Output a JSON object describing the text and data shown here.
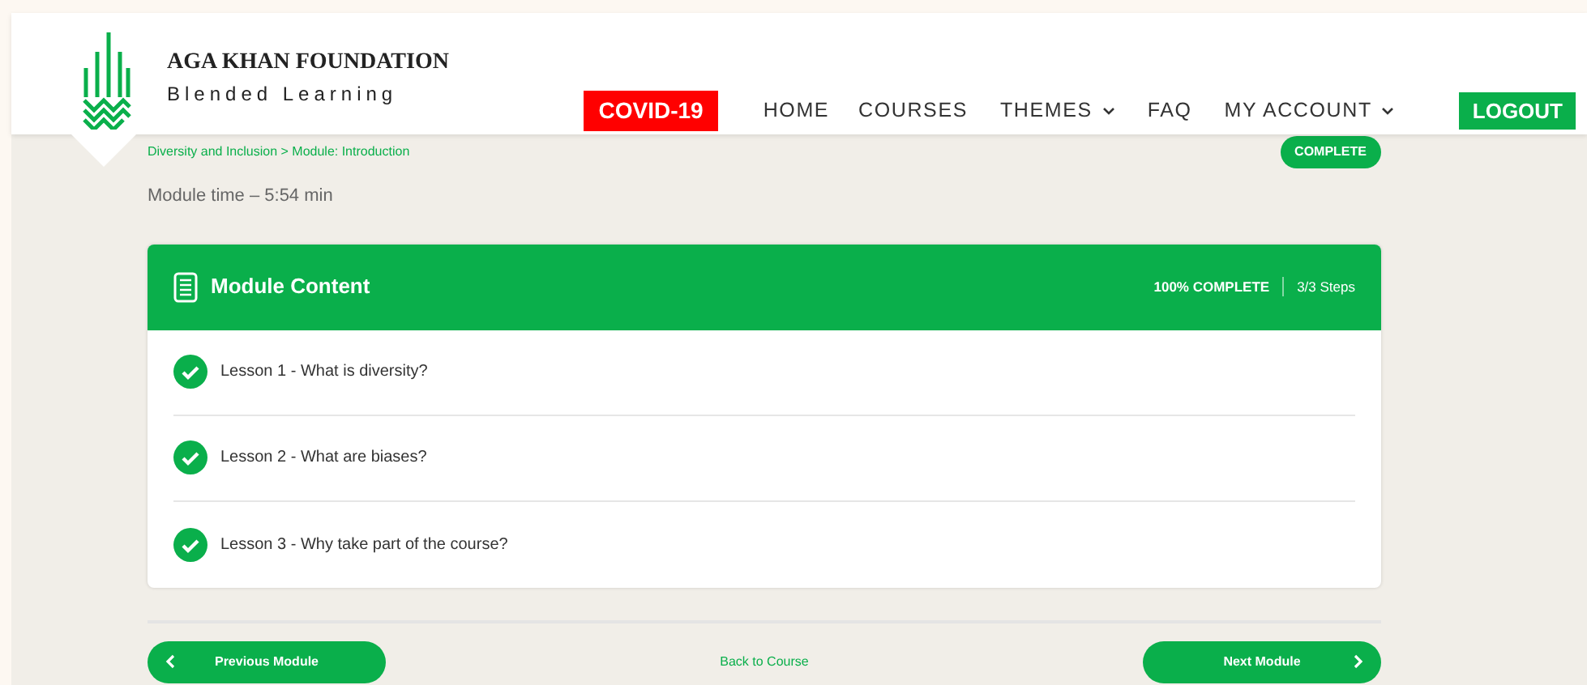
{
  "brand": {
    "title": "AGA KHAN FOUNDATION",
    "subtitle": "Blended Learning"
  },
  "nav": [
    {
      "label": "COVID-19",
      "kind": "alert",
      "dropdown": false
    },
    {
      "label": "HOME",
      "kind": "link",
      "dropdown": false
    },
    {
      "label": "COURSES",
      "kind": "link",
      "dropdown": false
    },
    {
      "label": "THEMES",
      "kind": "link",
      "dropdown": true
    },
    {
      "label": "FAQ",
      "kind": "link",
      "dropdown": false
    },
    {
      "label": "MY ACCOUNT",
      "kind": "link",
      "dropdown": true
    },
    {
      "label": "LOGOUT",
      "kind": "button",
      "dropdown": false
    }
  ],
  "breadcrumb": [
    "Diversity and Inclusion",
    "Module: Introduction"
  ],
  "breadcrumb_separator": ">",
  "status_badge": "COMPLETE",
  "module_time": "Module time – 5:54 min",
  "content": {
    "title": "Module Content",
    "progress": "100% COMPLETE",
    "steps": "3/3 Steps",
    "lessons": [
      {
        "title": "Lesson 1 - What is diversity?",
        "completed": true
      },
      {
        "title": "Lesson 2 - What are biases?",
        "completed": true
      },
      {
        "title": "Lesson 3 - Why take part of the course?",
        "completed": true
      }
    ]
  },
  "footer": {
    "previous": "Previous Module",
    "back": "Back to Course",
    "next": "Next Module"
  }
}
